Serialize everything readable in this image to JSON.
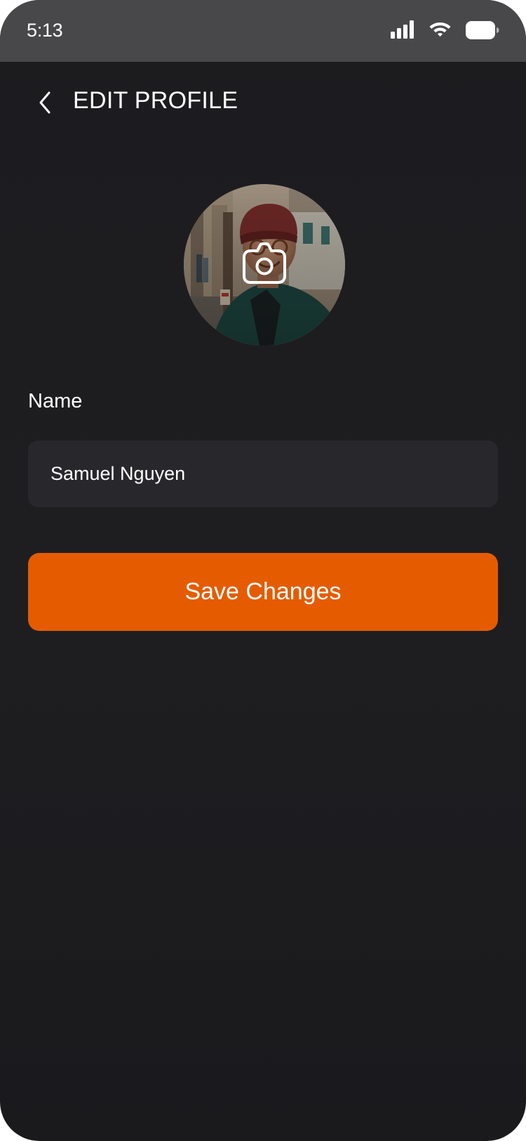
{
  "status_bar": {
    "time": "5:13",
    "icons": [
      "cellular-signal-icon",
      "wifi-icon",
      "battery-icon"
    ]
  },
  "header": {
    "back_icon": "chevron-left-icon",
    "title": "EDIT PROFILE"
  },
  "avatar": {
    "overlay_icon": "camera-icon"
  },
  "form": {
    "name_label": "Name",
    "name_value": "Samuel Nguyen"
  },
  "actions": {
    "save_label": "Save Changes"
  },
  "colors": {
    "background": "#1c1c1f",
    "status_bar": "#48484b",
    "field_background": "#28282c",
    "accent": "#e55b00",
    "text": "#ffffff"
  }
}
